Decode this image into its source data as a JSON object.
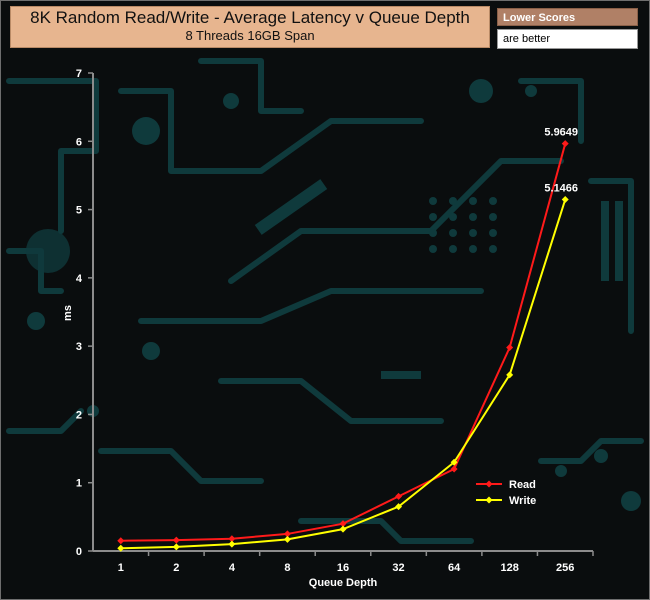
{
  "header": {
    "title": "8K Random Read/Write - Average Latency v Queue Depth",
    "subtitle": "8 Threads 16GB Span"
  },
  "note": {
    "heading": "Lower Scores",
    "text": "are better"
  },
  "colors": {
    "title_bg": "#e7b58f",
    "note_bg": "#b08066",
    "read": "#ff1a1a",
    "write": "#ffff00",
    "axis": "#8c8c8c",
    "text": "#ffffff",
    "background": "#0a0d0e",
    "circuit": "#0f3a3c"
  },
  "chart_data": {
    "type": "line",
    "title": "8K Random Read/Write - Average Latency v Queue Depth",
    "subtitle": "8 Threads 16GB Span",
    "xlabel": "Queue Depth",
    "ylabel": "ms",
    "categories": [
      "1",
      "2",
      "4",
      "8",
      "16",
      "32",
      "64",
      "128",
      "256"
    ],
    "ylim": [
      0,
      7
    ],
    "yticks": [
      0,
      1,
      2,
      3,
      4,
      5,
      6,
      7
    ],
    "grid": false,
    "legend_position": "lower-right",
    "series": [
      {
        "name": "Read",
        "color": "#ff1a1a",
        "values": [
          0.15,
          0.16,
          0.18,
          0.25,
          0.4,
          0.8,
          1.2,
          2.98,
          5.9649
        ]
      },
      {
        "name": "Write",
        "color": "#ffff00",
        "values": [
          0.04,
          0.06,
          0.1,
          0.17,
          0.32,
          0.65,
          1.3,
          2.58,
          5.1466
        ]
      }
    ],
    "annotations": [
      {
        "series": "Read",
        "index": 8,
        "text": "5.9649"
      },
      {
        "series": "Write",
        "index": 8,
        "text": "5.1466"
      }
    ]
  }
}
